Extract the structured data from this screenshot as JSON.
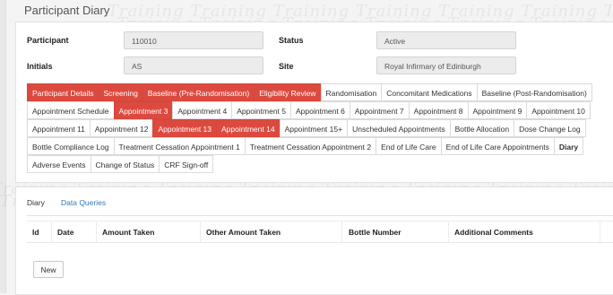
{
  "page": {
    "title": "Participant Diary"
  },
  "watermark": {
    "text": "Training Training Training Training Training Training Training Training Training"
  },
  "fields": {
    "participant": {
      "label": "Participant",
      "value": "110010"
    },
    "status": {
      "label": "Status",
      "value": "Active"
    },
    "initials": {
      "label": "Initials",
      "value": "AS"
    },
    "site": {
      "label": "Site",
      "value": "Royal Infirmary of Edinburgh"
    }
  },
  "colors": {
    "accent": "#dc4a3f",
    "link": "#337ab7"
  },
  "tab_rows": [
    [
      {
        "label": "Participant Details",
        "state": "complete"
      },
      {
        "label": "Screening",
        "state": "complete"
      },
      {
        "label": "Baseline (Pre-Randomisation)",
        "state": "complete"
      },
      {
        "label": "Eligibility Review",
        "state": "complete"
      },
      {
        "label": "Randomisation",
        "state": "default"
      },
      {
        "label": "Concomitant Medications",
        "state": "default"
      },
      {
        "label": "Baseline (Post-Randomisation)",
        "state": "default"
      }
    ],
    [
      {
        "label": "Appointment Schedule",
        "state": "default"
      },
      {
        "label": "Appointment 3",
        "state": "complete"
      },
      {
        "label": "Appointment 4",
        "state": "default"
      },
      {
        "label": "Appointment 5",
        "state": "default"
      },
      {
        "label": "Appointment 6",
        "state": "default"
      },
      {
        "label": "Appointment 7",
        "state": "default"
      },
      {
        "label": "Appointment 8",
        "state": "default"
      },
      {
        "label": "Appointment 9",
        "state": "default"
      },
      {
        "label": "Appointment 10",
        "state": "default"
      }
    ],
    [
      {
        "label": "Appointment 11",
        "state": "default"
      },
      {
        "label": "Appointment 12",
        "state": "default"
      },
      {
        "label": "Appointment 13",
        "state": "complete"
      },
      {
        "label": "Appointment 14",
        "state": "complete"
      },
      {
        "label": "Appointment 15+",
        "state": "default"
      },
      {
        "label": "Unscheduled Appointments",
        "state": "default"
      },
      {
        "label": "Bottle Allocation",
        "state": "default"
      },
      {
        "label": "Dose Change Log",
        "state": "default"
      }
    ],
    [
      {
        "label": "Bottle Compliance Log",
        "state": "default"
      },
      {
        "label": "Treatment Cessation Appointment 1",
        "state": "default"
      },
      {
        "label": "Treatment Cessation Appointment 2",
        "state": "default"
      },
      {
        "label": "End of Life Care",
        "state": "default"
      },
      {
        "label": "End of Life Care Appointments",
        "state": "default"
      },
      {
        "label": "Diary",
        "state": "active"
      }
    ],
    [
      {
        "label": "Adverse Events",
        "state": "default"
      },
      {
        "label": "Change of Status",
        "state": "default"
      },
      {
        "label": "CRF Sign-off",
        "state": "default"
      }
    ]
  ],
  "subtabs": {
    "diary": "Diary",
    "queries": "Data Queries"
  },
  "table": {
    "columns": [
      "Id",
      "Date",
      "Amount Taken",
      "Other Amount Taken",
      "Bottle Number",
      "Additional Comments"
    ]
  },
  "buttons": {
    "new": "New"
  }
}
